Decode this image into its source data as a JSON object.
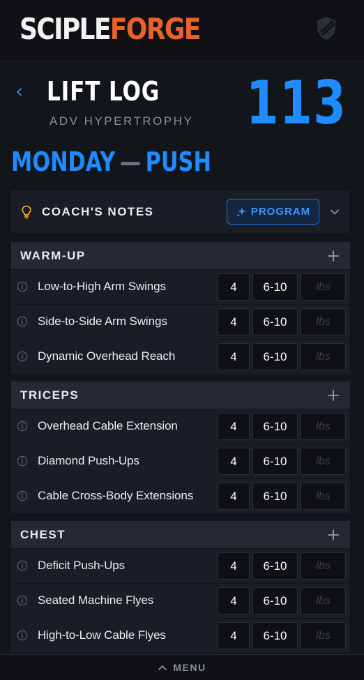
{
  "header": {
    "logo_part1": "SCIPLE",
    "logo_part2": "FORGE",
    "brand_white": "#f2f2f2",
    "brand_orange": "#e8622a",
    "shield_icon": "shield-icon"
  },
  "page": {
    "title": "LIFT LOG",
    "subtitle": "ADV HYPERTROPHY",
    "count": "113",
    "day": "MONDAY",
    "separator": "—",
    "focus": "PUSH",
    "accent": "#1e8bff"
  },
  "notes": {
    "label": "COACH'S NOTES",
    "program_label": "PROGRAM",
    "icons": [
      "lightbulb-icon",
      "sparkle-icon",
      "chevron-down-icon"
    ]
  },
  "sections": [
    {
      "title": "WARM-UP",
      "rows": [
        {
          "name": "Low-to-High Arm Swings",
          "sets": "4",
          "reps": "6-10",
          "weight_placeholder": "lbs"
        },
        {
          "name": "Side-to-Side Arm Swings",
          "sets": "4",
          "reps": "6-10",
          "weight_placeholder": "lbs"
        },
        {
          "name": "Dynamic Overhead Reach",
          "sets": "4",
          "reps": "6-10",
          "weight_placeholder": "lbs"
        }
      ]
    },
    {
      "title": "TRICEPS",
      "rows": [
        {
          "name": "Overhead Cable Extension",
          "sets": "4",
          "reps": "6-10",
          "weight_placeholder": "lbs"
        },
        {
          "name": "Diamond Push-Ups",
          "sets": "4",
          "reps": "6-10",
          "weight_placeholder": "lbs"
        },
        {
          "name": "Cable Cross-Body Extensions",
          "sets": "4",
          "reps": "6-10",
          "weight_placeholder": "lbs"
        }
      ]
    },
    {
      "title": "CHEST",
      "rows": [
        {
          "name": "Deficit Push-Ups",
          "sets": "4",
          "reps": "6-10",
          "weight_placeholder": "lbs"
        },
        {
          "name": "Seated Machine Flyes",
          "sets": "4",
          "reps": "6-10",
          "weight_placeholder": "lbs"
        },
        {
          "name": "High-to-Low Cable Flyes",
          "sets": "4",
          "reps": "6-10",
          "weight_placeholder": "lbs"
        }
      ]
    }
  ],
  "footer": {
    "menu_label": "MENU"
  }
}
